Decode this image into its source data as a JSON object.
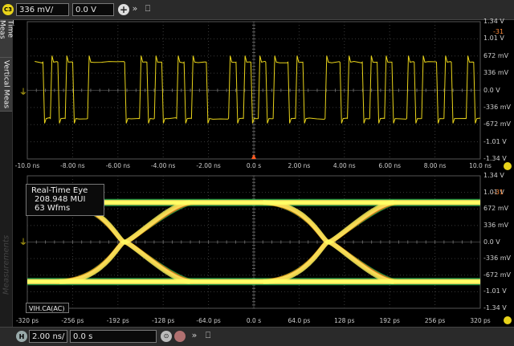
{
  "top_toolbar": {
    "channel_badge": "C3",
    "scale_value": "336 mV/",
    "offset_value": "0.0 V"
  },
  "bottom_toolbar": {
    "horizontal_badge": "H",
    "timebase_value": "2.00 ns/",
    "position_value": "0.0 s"
  },
  "sidebar": {
    "tabs": [
      "Time Meas",
      "Vertical Meas"
    ],
    "measurements_label": "Measurements"
  },
  "upper_plot": {
    "y_ticks": [
      "1.34 V",
      "1.01 V",
      "672 mV",
      "336 mV",
      "0.0 V",
      "-336 mV",
      "-672 mV",
      "-1.01 V",
      "-1.34 V"
    ],
    "x_ticks": [
      "-10.0 ns",
      "-8.00 ns",
      "-6.00 ns",
      "-4.00 ns",
      "-2.00 ns",
      "0.0 s",
      "2.00 ns",
      "4.00 ns",
      "6.00 ns",
      "8.00 ns",
      "10.0 ns"
    ],
    "marker_text": "-31"
  },
  "lower_plot": {
    "y_ticks": [
      "1.34 V",
      "1.01 V",
      "672 mV",
      "336 mV",
      "0.0 V",
      "-336 mV",
      "-672 mV",
      "-1.01 V",
      "-1.34 V"
    ],
    "x_ticks": [
      "-320 ps",
      "-256 ps",
      "-192 ps",
      "-128 ps",
      "-64.0 ps",
      "0.0 s",
      "64.0 ps",
      "128 ps",
      "192 ps",
      "256 ps",
      "320 ps"
    ],
    "marker_text": "-31",
    "eye_box": {
      "title": "Real-Time Eye",
      "mui": "208.948 MUI",
      "wfms": "63 Wfms"
    },
    "label_box": "VIH.CA(AC)"
  },
  "colors": {
    "trace": "#e8d31a",
    "eye_hot": "#ffff66",
    "eye_mid": "#ff7a00",
    "eye_cool": "#2db84d",
    "grid": "#3a3a3a"
  }
}
